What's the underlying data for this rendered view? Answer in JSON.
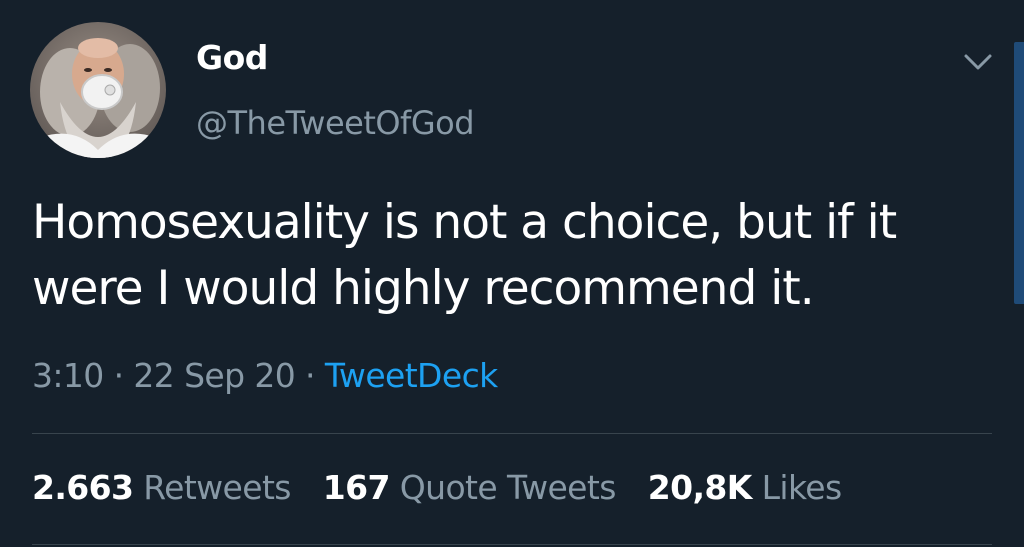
{
  "tweet": {
    "author": {
      "display_name": "God",
      "handle": "@TheTweetOfGod"
    },
    "text": "Homosexuality is not a choice, but if it were I would highly recommend it.",
    "time": "3:10",
    "date": "22 Sep 20",
    "source": "TweetDeck",
    "separator": "·"
  },
  "stats": [
    {
      "count": "2.663",
      "label": "Retweets"
    },
    {
      "count": "167",
      "label": "Quote Tweets"
    },
    {
      "count": "20,8K",
      "label": "Likes"
    }
  ],
  "icons": {
    "caret": "chevron-down-icon",
    "avatar": "avatar-image"
  },
  "colors": {
    "background": "#15202b",
    "secondary_text": "#8899a6",
    "link": "#1da1f2",
    "divider": "#38444d"
  }
}
